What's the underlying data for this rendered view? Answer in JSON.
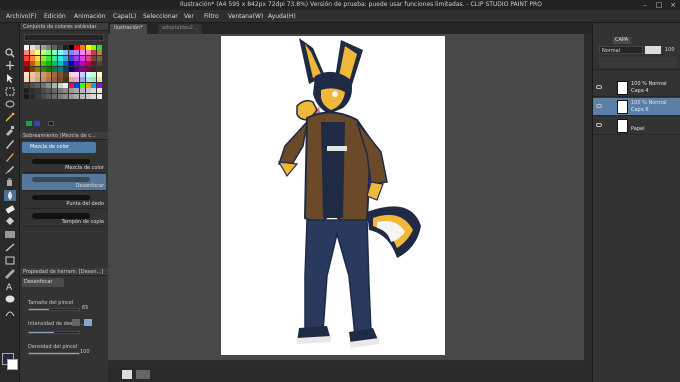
{
  "window": {
    "title": "Ilustración* (A4 595 x 842px 72dpi 73.8%)  Versión de prueba: puede usar funciones limitadas. - CLIP STUDIO PAINT PRO",
    "controls": [
      "–",
      "□",
      "×"
    ]
  },
  "menu": [
    "Archivo(F)",
    "Edición",
    "Animación",
    "Capa(L)",
    "Seleccionar",
    "Ver",
    "Filtro",
    "Ventana(W)",
    "Ayuda(H)"
  ],
  "tabs": [
    {
      "label": "Ilustración*",
      "active": true
    },
    {
      "label": "adoptables2...",
      "active": false
    }
  ],
  "panels": {
    "color_set": {
      "title": "Conjunto de colores estándar"
    },
    "subtool": {
      "title": "Sobreamiento (Mezcla de c..."
    },
    "subtool_group": {
      "label": "Mezcla de color"
    },
    "brushes": [
      {
        "label": "Mezcla de color",
        "selected": false
      },
      {
        "label": "Desenfocar",
        "selected": true
      },
      {
        "label": "Punta del dedo",
        "selected": false
      },
      {
        "label": "Tampón de copia",
        "selected": false
      }
    ],
    "property": {
      "title": "Propiedad de herram. [Desen...]",
      "tool_name": "Desenfocar",
      "size_label": "Tamaño del pincel",
      "size_value": "65",
      "intensity_label": "Intensidad de desen...",
      "intensity_value": "",
      "density_label": "Densidad del pincel",
      "density_value": "100",
      "size_level": 0.4,
      "density_level": 1.0
    }
  },
  "layers": {
    "tab_label": "CAPA",
    "blend_mode": "Normal",
    "opacity": "100",
    "items": [
      {
        "line1": "100 % Normal",
        "line2": "Capa 4",
        "selected": false
      },
      {
        "line1": "100 % Normal",
        "line2": "Capa 6",
        "selected": true
      },
      {
        "line1": "",
        "line2": "Papel",
        "selected": false
      }
    ]
  },
  "colors": {
    "accent": "#6c8fb5",
    "layer_selected": "#5b7fa6",
    "canvas_bg": "#484848",
    "paper": "#ffffff",
    "character_dark": "#1f2a44",
    "fur_yellow": "#f0b838",
    "jacket_brown": "#6b4a2a"
  },
  "swatches": [
    "#ffffff",
    "#e0e0e0",
    "#c0c0c0",
    "#a0a0a0",
    "#808080",
    "#606060",
    "#404040",
    "#202020",
    "#000000",
    "#ff0000",
    "#ff8000",
    "#ffff00",
    "#80ff00",
    "#00ff00",
    "#ff8080",
    "#ffc080",
    "#ffff80",
    "#c0ff80",
    "#80ff80",
    "#80ffc0",
    "#80ffff",
    "#80c0ff",
    "#8080ff",
    "#c080ff",
    "#ff80ff",
    "#ff80c0",
    "#c04040",
    "#c08040",
    "#ff4040",
    "#ff8040",
    "#ffe040",
    "#a0e040",
    "#40e040",
    "#40e0a0",
    "#40e0e0",
    "#40a0e0",
    "#4040e0",
    "#a040e0",
    "#e040e0",
    "#e04080",
    "#804040",
    "#806040",
    "#c00000",
    "#c06000",
    "#c0c000",
    "#60c000",
    "#00c000",
    "#00c060",
    "#00c0c0",
    "#0060c0",
    "#0000c0",
    "#6000c0",
    "#c000c0",
    "#c00060",
    "#602020",
    "#604020",
    "#800000",
    "#804000",
    "#808000",
    "#408000",
    "#008000",
    "#008040",
    "#008080",
    "#004080",
    "#000080",
    "#400080",
    "#800080",
    "#800040",
    "#402020",
    "#403020",
    "#ffe0c0",
    "#f0c8a0",
    "#e0b080",
    "#d09868",
    "#c08050",
    "#a06840",
    "#805030",
    "#603820",
    "#ffd0d0",
    "#ffd0ff",
    "#d0d0ff",
    "#d0ffff",
    "#d0ffd0",
    "#ffffd0",
    "#f8d8b8",
    "#e8c098",
    "#d8a878",
    "#c89060",
    "#b07848",
    "#986038",
    "#784828",
    "#583018",
    "#e8a0a0",
    "#e8a0e8",
    "#a0a0e8",
    "#a0e8e8",
    "#a0e8a0",
    "#e8e8a0",
    "#404040",
    "#505050",
    "#606060",
    "#707070",
    "#909090",
    "#b0b0b0",
    "#d0d0d0",
    "#f0f0f0",
    "#ff0040",
    "#0040ff",
    "#40ff00",
    "#ffa000",
    "#00a0ff",
    "#a000ff",
    "#202020",
    "#303030",
    "#383838",
    "#484848",
    "#585858",
    "#686868",
    "#787878",
    "#888888",
    "#989898",
    "#a8a8a8",
    "#b8b8b8",
    "#c8c8c8",
    "#d8d8d8",
    "#e8e8e8",
    "#1a1a1a",
    "#2a2a2a",
    "#3a3a3a",
    "#4a4a4a",
    "#5a5a5a",
    "#6a6a6a",
    "#7a7a7a",
    "#8a8a8a",
    "#9a9a9a",
    "#aaaaaa",
    "#bababa",
    "#cacaca",
    "#dadada",
    "#eaeaea"
  ]
}
